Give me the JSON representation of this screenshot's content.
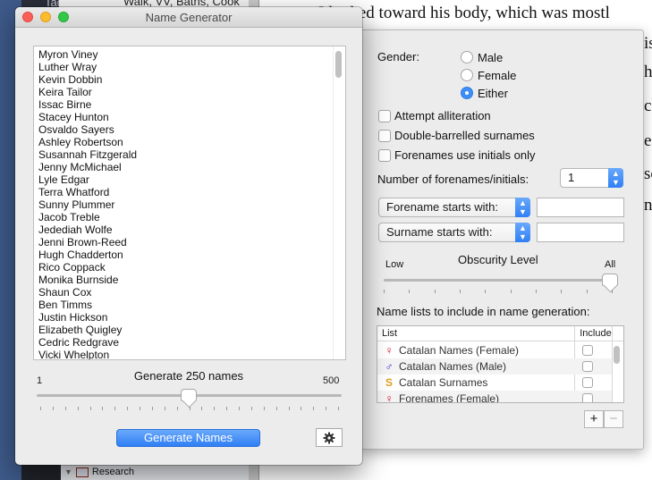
{
  "background": {
    "sidebar_tags_label": "Tags",
    "binder_top_item": "Walk, VV, Baths, Cook",
    "binder_research_label": "Research",
    "editor_lines": [
      "I looked toward his body, which was mostl",
      "is",
      "h",
      "cl",
      "e.",
      "sc",
      "nc"
    ]
  },
  "window": {
    "title": "Name Generator"
  },
  "names": [
    "Myron Viney",
    "Luther Wray",
    "Kevin Dobbin",
    "Keira Tailor",
    "Issac Birne",
    "Stacey Hunton",
    "Osvaldo Sayers",
    "Ashley Robertson",
    "Susannah Fitzgerald",
    "Jenny McMichael",
    "Lyle Edgar",
    "Terra Whatford",
    "Sunny Plummer",
    "Jacob Treble",
    "Jedediah Wolfe",
    "Jenni Brown-Reed",
    "Hugh Chadderton",
    "Rico Coppack",
    "Monika Burnside",
    "Shaun Cox",
    "Ben Timms",
    "Justin Hickson",
    "Elizabeth Quigley",
    "Cedric Redgrave",
    "Vicki Whelpton"
  ],
  "count_slider": {
    "label": "Generate 250 names",
    "min_label": "1",
    "max_label": "500",
    "min": 1,
    "max": 500,
    "value": 250
  },
  "generate_button_label": "Generate Names",
  "settings_icon": "gear-icon",
  "options": {
    "gender_label": "Gender:",
    "gender_options": [
      "Male",
      "Female",
      "Either"
    ],
    "gender_selected": "Either",
    "checkboxes": [
      {
        "label": "Attempt alliteration",
        "checked": false
      },
      {
        "label": "Double-barrelled surnames",
        "checked": false
      },
      {
        "label": "Forenames use initials only",
        "checked": false
      }
    ],
    "num_forenames_label": "Number of forenames/initials:",
    "num_forenames_value": "1",
    "forename_filter_mode": "Forename starts with:",
    "forename_filter_value": "",
    "surname_filter_mode": "Surname starts with:",
    "surname_filter_value": "",
    "obscurity": {
      "title": "Obscurity Level",
      "low_label": "Low",
      "high_label": "All",
      "value_fraction": 1.0
    },
    "lists_label": "Name lists to include in name generation:",
    "lists_table": {
      "columns": [
        "List",
        "Include"
      ],
      "rows": [
        {
          "symbol": "♀",
          "type": "female",
          "name": "Catalan Names (Female)",
          "include": false
        },
        {
          "symbol": "♂",
          "type": "male",
          "name": "Catalan Names (Male)",
          "include": false
        },
        {
          "symbol": "S",
          "type": "surname",
          "name": "Catalan Surnames",
          "include": false
        },
        {
          "symbol": "♀",
          "type": "female",
          "name": "Forenames (Female)",
          "include": false
        }
      ]
    },
    "add_label": "+",
    "remove_label": "−"
  },
  "colors": {
    "accent": "#3d8ef7",
    "female": "#d0021b",
    "male": "#3b1fd1",
    "surname": "#e0a11b"
  }
}
